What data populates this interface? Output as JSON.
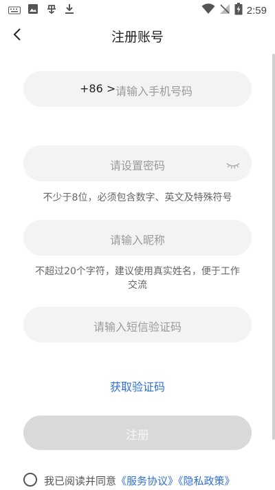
{
  "status_bar": {
    "time": "2:59"
  },
  "header": {
    "title": "注册账号"
  },
  "phone": {
    "country_code": "+86 >",
    "placeholder": "请输入手机号码"
  },
  "password": {
    "placeholder": "请设置密码",
    "hint": "不少于8位，必须包含数字、英文及特殊符号"
  },
  "nickname": {
    "placeholder": "请输入昵称",
    "hint_line1": "不超过20个字符，建议使用真实姓名，便于工作",
    "hint_line2": "交流"
  },
  "sms_code": {
    "placeholder": "请输入短信验证码"
  },
  "get_code": {
    "label": "获取验证码"
  },
  "register_button": {
    "label": "注册"
  },
  "agreement": {
    "prefix": "我已阅读并同意",
    "service": "《服务协议》",
    "privacy": "《隐私政策》"
  },
  "colors": {
    "link": "#2f6fd6",
    "field_bg": "#f3f3f3"
  }
}
